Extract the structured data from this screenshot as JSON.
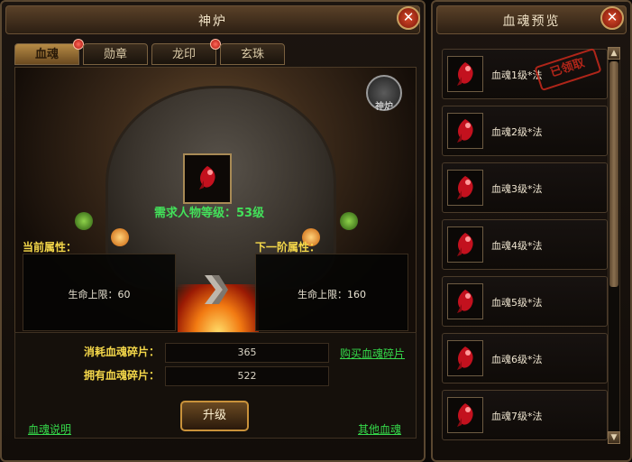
{
  "left_panel": {
    "title": "神炉",
    "tabs": [
      {
        "label": "血魂",
        "active": true,
        "has_dot": true
      },
      {
        "label": "勋章",
        "active": false,
        "has_dot": false
      },
      {
        "label": "龙印",
        "active": false,
        "has_dot": true
      },
      {
        "label": "玄珠",
        "active": false,
        "has_dot": false
      }
    ],
    "badge_label": "神炉",
    "required_level": "需求人物等级：53级",
    "current_attr": {
      "heading": "当前属性：",
      "text": "生命上限：60"
    },
    "next_attr": {
      "heading": "下一阶属性：",
      "text": "生命上限：160"
    },
    "costs": {
      "consume_label": "消耗血魂碎片：",
      "consume_value": "365",
      "own_label": "拥有血魂碎片：",
      "own_value": "522"
    },
    "buy_link": "购买血魂碎片",
    "help_link": "血魂说明",
    "other_link": "其他血魂",
    "upgrade_button": "升级"
  },
  "right_panel": {
    "title": "血魂预览",
    "items": [
      {
        "label": "血魂1级*法",
        "stamp": "已领取"
      },
      {
        "label": "血魂2级*法"
      },
      {
        "label": "血魂3级*法"
      },
      {
        "label": "血魂4级*法"
      },
      {
        "label": "血魂5级*法"
      },
      {
        "label": "血魂6级*法"
      },
      {
        "label": "血魂7级*法"
      }
    ]
  },
  "colors": {
    "gold_text": "#f5d84a",
    "green_text": "#35d84a",
    "stamp_red": "#c0281b"
  },
  "icons": [
    "close-icon",
    "blood-soul-gem-icon",
    "skull-emblem-icon",
    "arrow-right-icon",
    "scroll-up-icon",
    "scroll-down-icon"
  ]
}
